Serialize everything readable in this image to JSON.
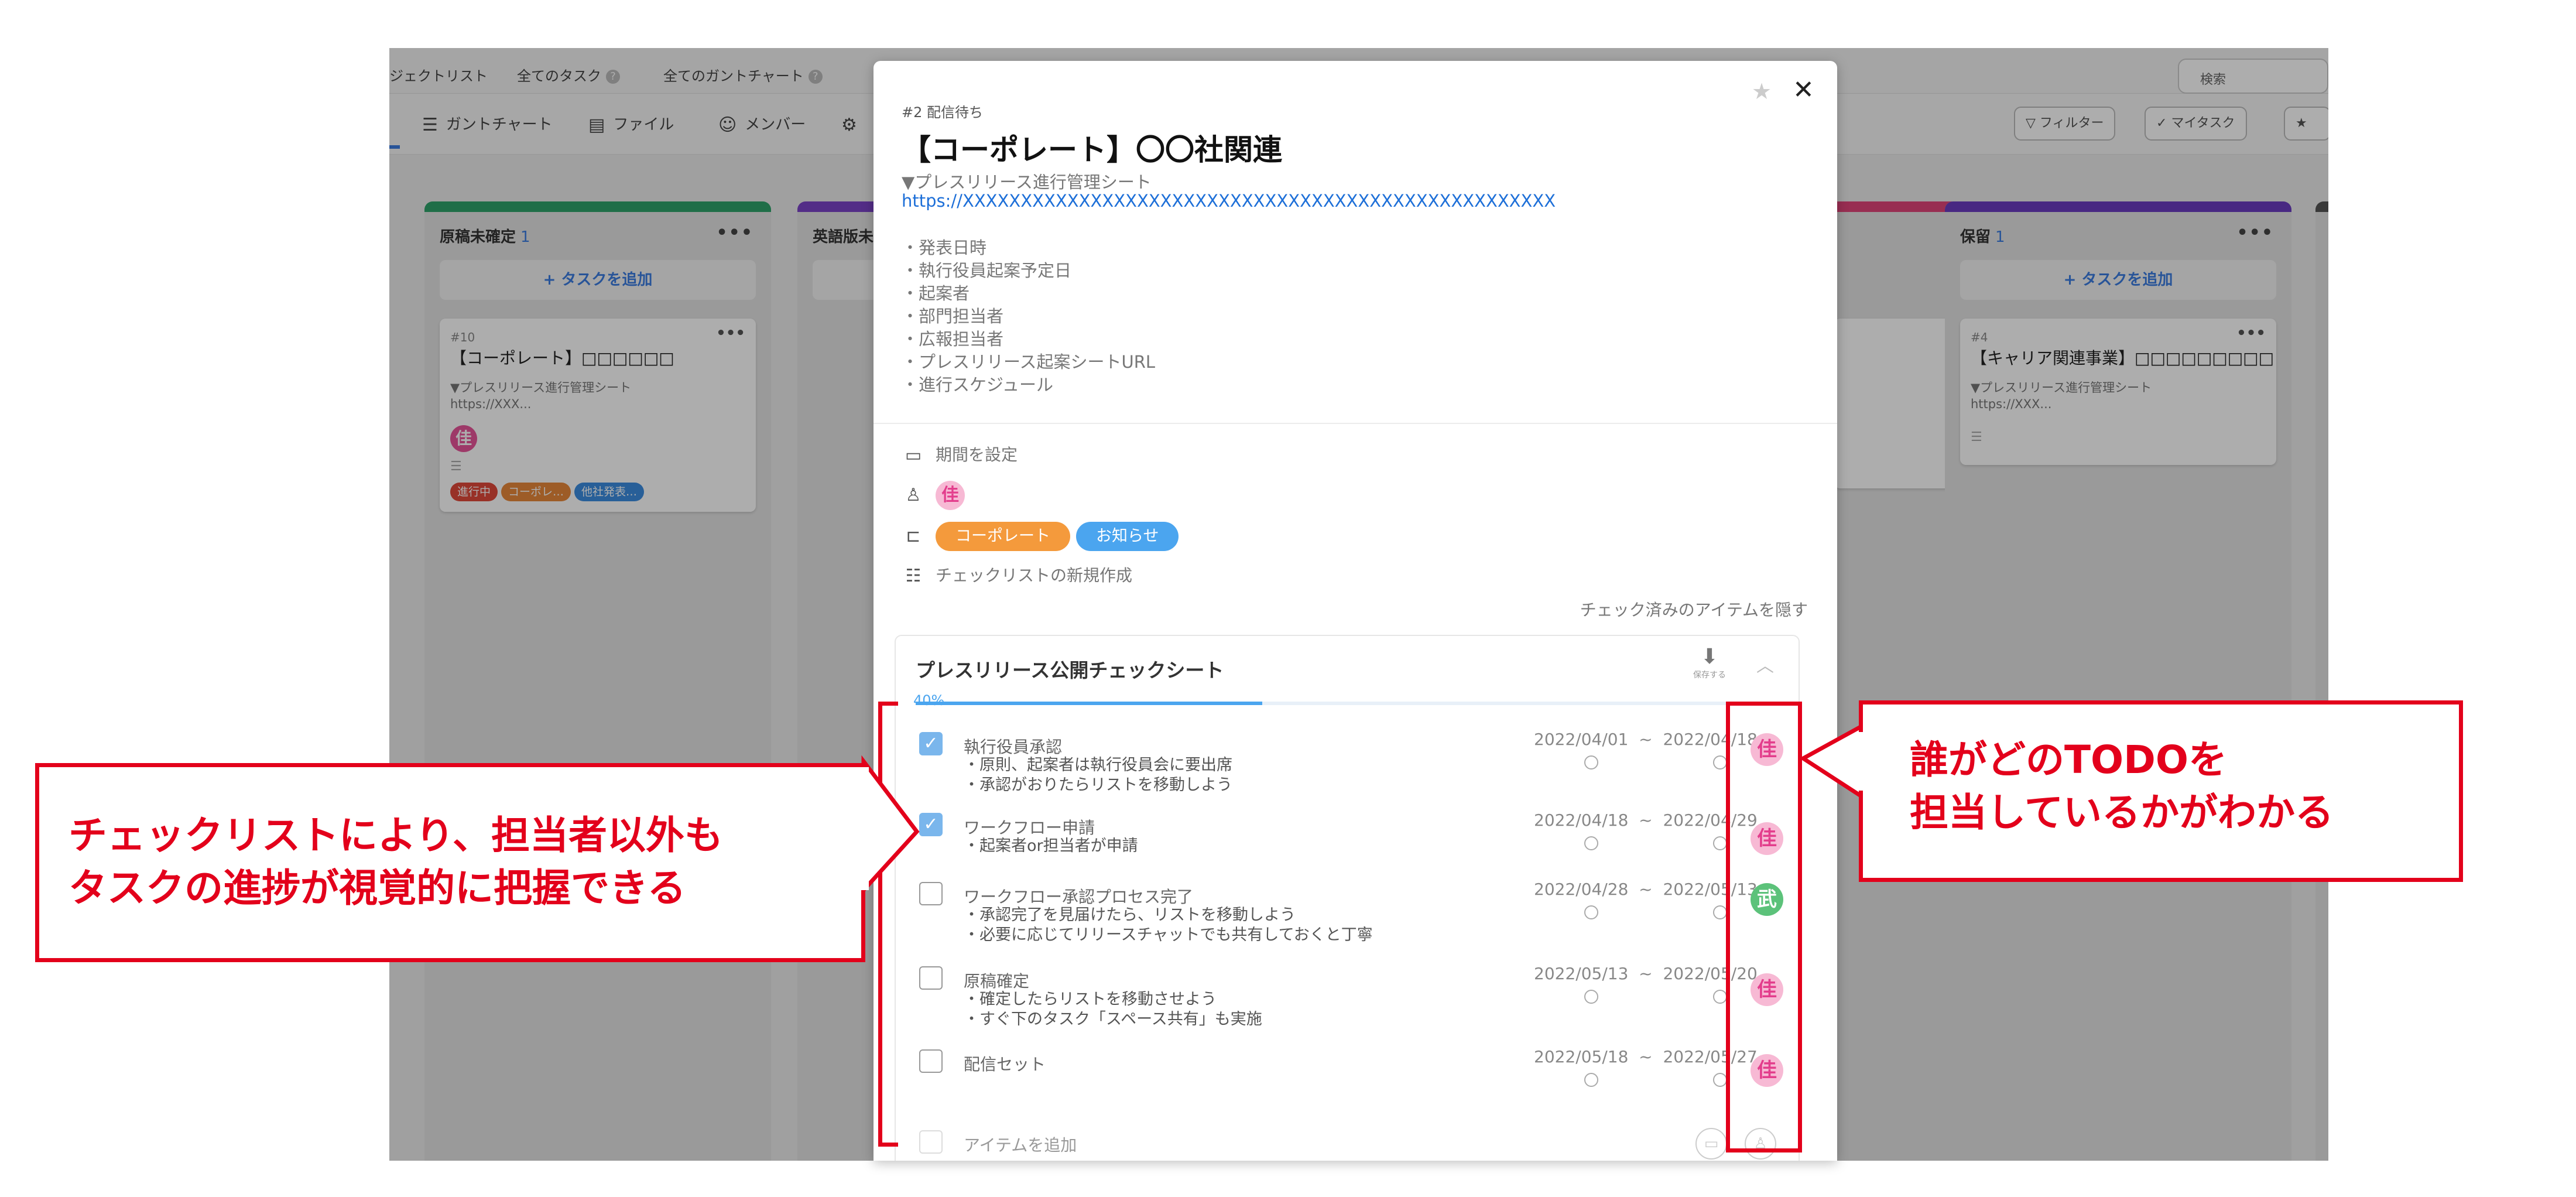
{
  "nav": {
    "project_list": "ジェクトリスト",
    "all_tasks": "全てのタスク",
    "all_gantt": "全てのガントチャート",
    "help_glyph": "?",
    "search_label": "検索"
  },
  "toolbar": {
    "gantt": "ガントチャート",
    "file": "ファイル",
    "member": "メンバー",
    "filter": "フィルター",
    "mytask": "マイタスク"
  },
  "board": {
    "columns": [
      {
        "name": "原稿未確定",
        "count": "1",
        "color": "#2ea36a",
        "add": "+ タスクを追加",
        "card": {
          "num": "#10",
          "title": "【コーポレート】□□□□□□",
          "desc": "▼プレスリリース進行管理シート\nhttps://XXX...",
          "avatar": "佳",
          "tags": [
            {
              "label": "進行中",
              "color": "#e0493a"
            },
            {
              "label": "コーポレ…",
              "color": "#e8883a"
            },
            {
              "label": "他社発表…",
              "color": "#3b8de0"
            }
          ]
        }
      },
      {
        "name": "英語版未",
        "count": "",
        "color": "#7b43c7"
      },
      {
        "name": "",
        "count": "",
        "color": "#e0447a"
      },
      {
        "name": "保留",
        "count": "1",
        "color": "#6a3bc0",
        "add": "+ タスクを追加",
        "card": {
          "num": "#4",
          "title": "【キャリア関連事業】□□□□□□□□□",
          "desc": "▼プレスリリース進行管理シート\nhttps://XXX..."
        }
      }
    ]
  },
  "modal": {
    "status": "#2 配信待ち",
    "title": "【コーポレート】〇〇社関連",
    "sheet_label": "▼プレスリリース進行管理シート",
    "link": "https://XXXXXXXXXXXXXXXXXXXXXXXXXXXXXXXXXXXXXXXXXXXXXXXXXXX",
    "body_lines": "・発表日時\n・執行役員起案予定日\n・起案者\n・部門担当者\n・広報担当者\n・プレスリリース起案シートURL\n・進行スケジュール",
    "period_label": "期間を設定",
    "assignee": "佳",
    "tags": [
      {
        "label": "コーポレート",
        "color": "#f49a3c"
      },
      {
        "label": "お知らせ",
        "color": "#4ba5ef"
      }
    ],
    "new_checklist": "チェックリストの新規作成",
    "hide_checked": "チェック済みのアイテムを隠す",
    "checklist_title": "プレスリリース公開チェックシート",
    "save_label": "保存する",
    "progress_text": "40%",
    "progress": 0.4,
    "add_item": "アイテムを追加",
    "items": [
      {
        "checked": true,
        "title": "執行役員承認",
        "note": "・原則、起案者は執行役員会に要出席\n・承認がおりたらリストを移動しよう",
        "dates": "2022/04/01  ~  2022/04/18",
        "avatar": "佳",
        "avatar_color": "#f7b9d4"
      },
      {
        "checked": true,
        "title": "ワークフロー申請",
        "note": "・起案者or担当者が申請",
        "dates": "2022/04/18  ~  2022/04/29",
        "avatar": "佳",
        "avatar_color": "#f7b9d4"
      },
      {
        "checked": false,
        "title": "ワークフロー承認プロセス完了",
        "note": "・承認完了を見届けたら、リストを移動しよう\n・必要に応じてリリースチャットでも共有しておくと丁寧",
        "dates": "2022/04/28  ~  2022/05/13",
        "avatar": "武",
        "avatar_color": "#5cc27a"
      },
      {
        "checked": false,
        "title": "原稿確定",
        "note": "・確定したらリストを移動させよう\n・すぐ下のタスク「スペース共有」も実施",
        "dates": "2022/05/13  ~  2022/05/20",
        "avatar": "佳",
        "avatar_color": "#f7b9d4"
      },
      {
        "checked": false,
        "title": "配信セット",
        "note": "",
        "dates": "2022/05/18  ~  2022/05/27",
        "avatar": "佳",
        "avatar_color": "#f7b9d4"
      }
    ]
  },
  "callouts": {
    "left": "チェックリストにより、担当者以外も\nタスクの進捗が視覚的に把握できる",
    "right": "誰がどのTODOを\n担当しているかがわかる"
  },
  "colors": {
    "annotation_red": "#e3001b",
    "link_blue": "#1d6fd8",
    "progress_blue": "#4ba5ef"
  }
}
